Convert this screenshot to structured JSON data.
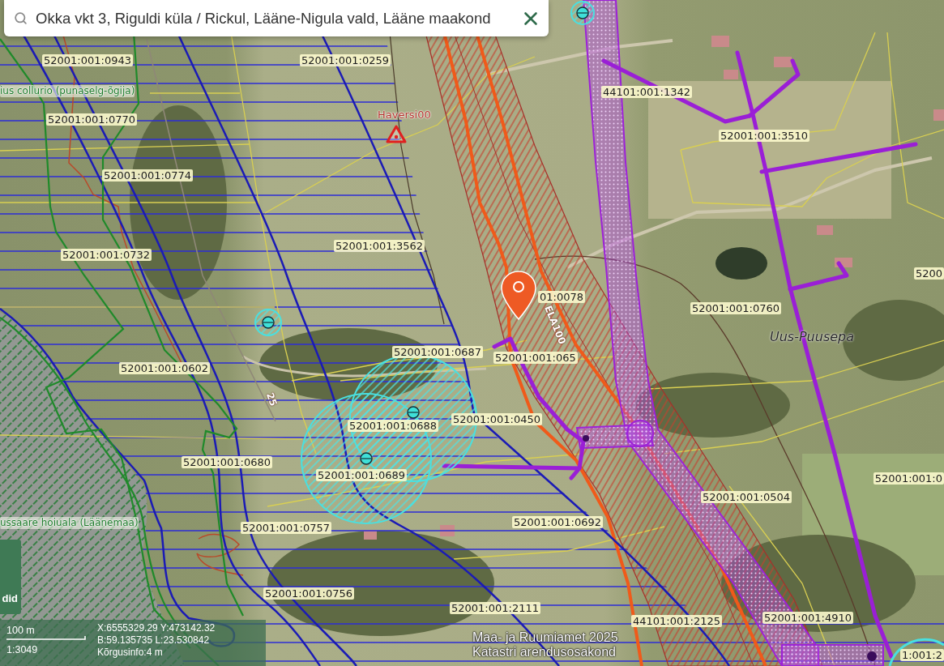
{
  "search_bar": {
    "value": "Okka vkt 3, Riguldi küla / Rickul, Lääne-Nigula vald, Lääne maakond"
  },
  "map_labels": [
    {
      "kind": "parcel",
      "text": "52001:001:0943"
    },
    {
      "kind": "parcel",
      "text": "52001:001:0259"
    },
    {
      "kind": "area",
      "text": "ius collurio (punaselg-õgija)"
    },
    {
      "kind": "station",
      "text": "Haversi00"
    },
    {
      "kind": "parcel",
      "text": "44101:001:1342"
    },
    {
      "kind": "parcel",
      "text": "52001:001:0770"
    },
    {
      "kind": "parcel",
      "text": "52001:001:3510"
    },
    {
      "kind": "parcel",
      "text": "52001:001:0774"
    },
    {
      "kind": "parcel",
      "text": "52001:001:3562"
    },
    {
      "kind": "parcel",
      "text": "52001:001:0732"
    },
    {
      "kind": "parcel",
      "text": "5200"
    },
    {
      "kind": "parcel",
      "text": "01:0078"
    },
    {
      "kind": "road",
      "text": "ELA100"
    },
    {
      "kind": "parcel",
      "text": "52001:001:0760"
    },
    {
      "kind": "place",
      "text": "Uus-Puusepa"
    },
    {
      "kind": "parcel",
      "text": "52001:001:0687"
    },
    {
      "kind": "parcel",
      "text": "52001:001:065"
    },
    {
      "kind": "parcel",
      "text": "52001:001:0602"
    },
    {
      "kind": "road",
      "text": "25"
    },
    {
      "kind": "parcel",
      "text": "52001:001:0688"
    },
    {
      "kind": "parcel",
      "text": "52001:001:0450"
    },
    {
      "kind": "parcel",
      "text": "52001:001:0680"
    },
    {
      "kind": "parcel",
      "text": "52001:001:0689"
    },
    {
      "kind": "parcel",
      "text": "52001:001:0"
    },
    {
      "kind": "parcel",
      "text": "52001:001:0504"
    },
    {
      "kind": "area",
      "text": "ussaare hoiuala (Läänemaa)"
    },
    {
      "kind": "parcel",
      "text": "52001:001:0692"
    },
    {
      "kind": "parcel",
      "text": "52001:001:0757"
    },
    {
      "kind": "parcel",
      "text": "52001:001:0756"
    },
    {
      "kind": "parcel",
      "text": "52001:001:2111"
    },
    {
      "kind": "parcel",
      "text": "44101:001:2125"
    },
    {
      "kind": "parcel",
      "text": "52001:001:4910"
    },
    {
      "kind": "parcel",
      "text": "1:001:2"
    }
  ],
  "side_button": {
    "label": "did"
  },
  "scale": {
    "distance": "100 m",
    "ratio": "1:3049"
  },
  "coordinates": [
    "X:6555329.29 Y:473142.32",
    "B:59.135735 L:23.530842",
    "Kõrgusinfo:4 m"
  ],
  "attribution": [
    "Maa- ja Ruumiamet 2025",
    "Katastri arendusosakond"
  ]
}
